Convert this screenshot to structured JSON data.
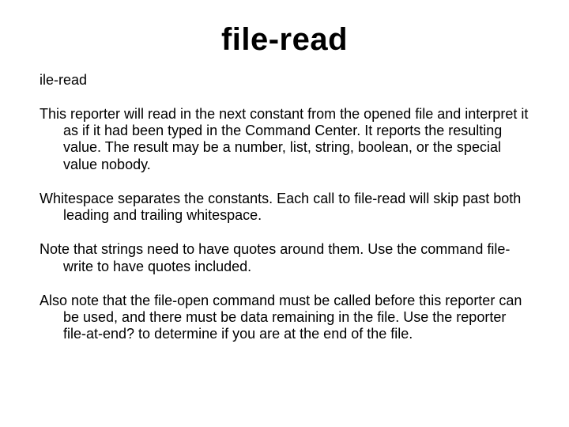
{
  "title": "file-read",
  "subheader": "ile-read",
  "paragraphs": [
    "This reporter will read in the next constant from the opened file and interpret it as if it had been typed in the Command Center. It reports the resulting value. The result may be a number, list, string, boolean, or the special value nobody.",
    "Whitespace separates the constants. Each call to file-read will skip past both leading and trailing whitespace.",
    "Note that strings need to have quotes around them. Use the command file-write to have quotes included.",
    "Also note that the file-open command must be called before this reporter can be used, and there must be data remaining in the file. Use the reporter file-at-end? to determine if you are at the end of the file."
  ]
}
